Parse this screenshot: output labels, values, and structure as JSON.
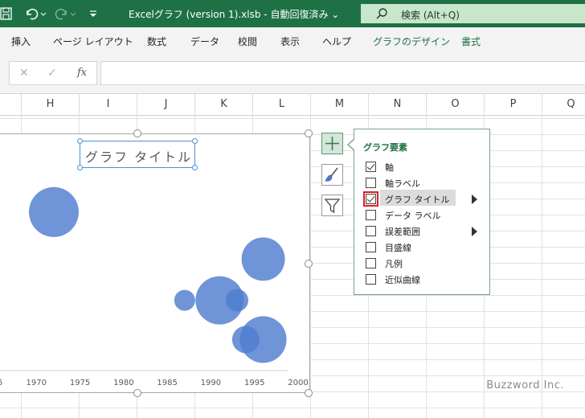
{
  "window": {
    "title": "Excelグラフ (version 1).xlsb  -  自動回復済み  ⌄",
    "search_placeholder": "検索 (Alt+Q)"
  },
  "ribbon_tabs": [
    {
      "label": "挿入"
    },
    {
      "label": "ページ レイアウト"
    },
    {
      "label": "数式"
    },
    {
      "label": "データ"
    },
    {
      "label": "校閲"
    },
    {
      "label": "表示"
    },
    {
      "label": "ヘルプ"
    },
    {
      "label": "グラフのデザイン"
    },
    {
      "label": "書式"
    }
  ],
  "formula_bar": {
    "fx": "fx",
    "cancel": "✕",
    "enter": "✓"
  },
  "columns": [
    "H",
    "I",
    "J",
    "K",
    "L",
    "M",
    "N",
    "O",
    "P",
    "Q"
  ],
  "chart": {
    "title": "グラフ タイトル"
  },
  "chart_data": {
    "type": "scatter",
    "subtype": "bubble",
    "x_ticks": [
      "1970",
      "1975",
      "1980",
      "1985",
      "1990",
      "1995",
      "2000"
    ],
    "xlim": [
      1965,
      2000
    ],
    "title": "グラフ タイトル",
    "color": "#4f7ccf",
    "points": [
      {
        "x": 1972,
        "y": 0.8,
        "size": 31
      },
      {
        "x": 1996,
        "y": 0.56,
        "size": 27
      },
      {
        "x": 1987,
        "y": 0.35,
        "size": 13
      },
      {
        "x": 1991,
        "y": 0.35,
        "size": 30
      },
      {
        "x": 1993,
        "y": 0.35,
        "size": 14
      },
      {
        "x": 1996,
        "y": 0.15,
        "size": 29
      },
      {
        "x": 1994,
        "y": 0.15,
        "size": 17
      }
    ]
  },
  "chart_elements_panel": {
    "header": "グラフ要素",
    "items": [
      {
        "label": "軸",
        "checked": true
      },
      {
        "label": "軸ラベル",
        "checked": false
      },
      {
        "label": "グラフ タイトル",
        "checked": true
      },
      {
        "label": "データ ラベル",
        "checked": false
      },
      {
        "label": "誤差範囲",
        "checked": false
      },
      {
        "label": "目盛線",
        "checked": false
      },
      {
        "label": "凡例",
        "checked": false
      },
      {
        "label": "近似曲線",
        "checked": false
      }
    ]
  },
  "watermark": "Buzzword Inc.",
  "colors": {
    "titlebar": "#1e7145",
    "accent": "#1e7145",
    "bubble": "#4f7ccf"
  }
}
